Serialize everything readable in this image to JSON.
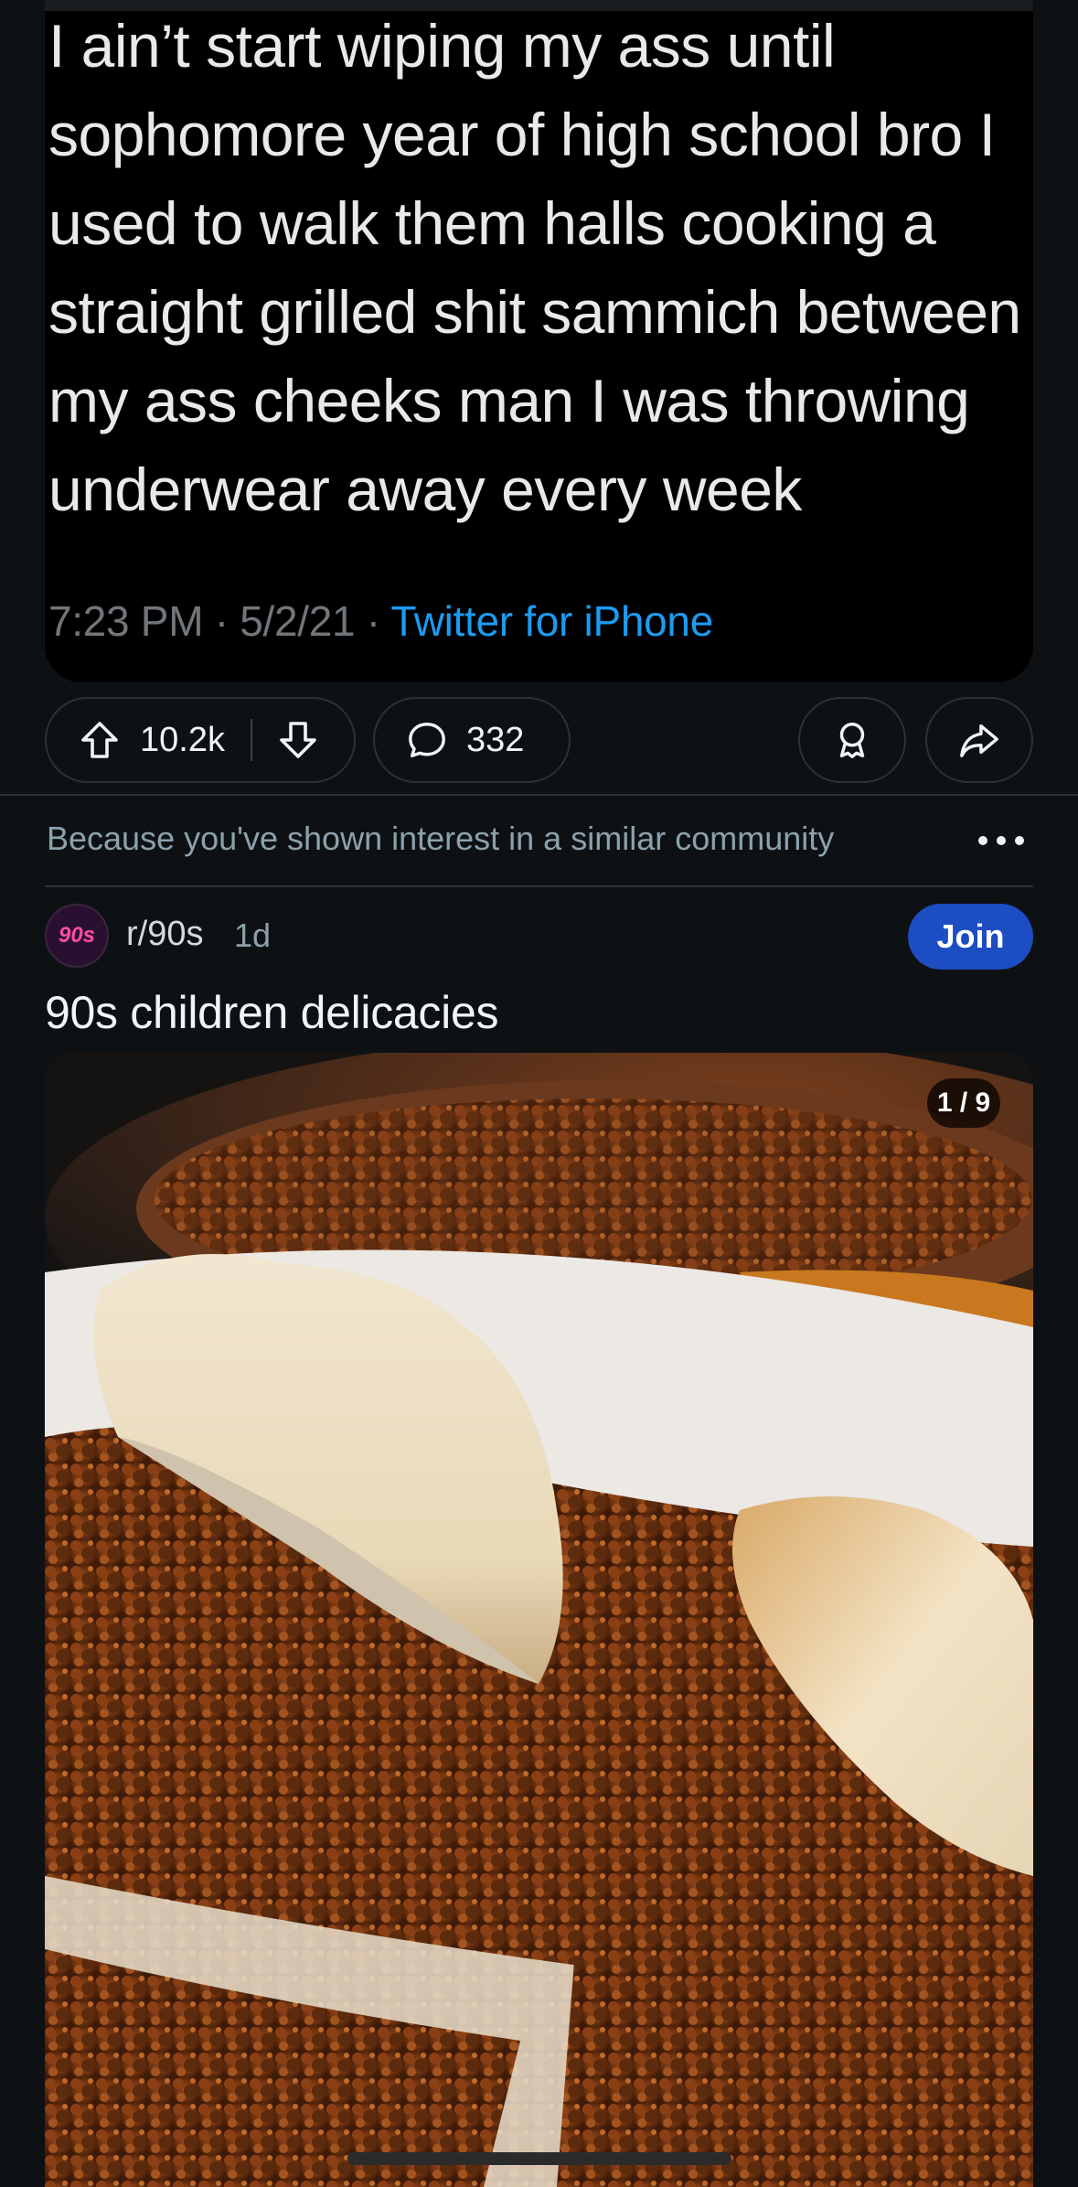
{
  "tweet": {
    "text": "I ain’t start wiping my ass until sophomore year of high school bro I used to walk them halls cooking a straight grilled shit sammich between my ass cheeks man I was throwing underwear away every week",
    "lines": [
      "I ain’t start wiping my ass until",
      "sophomore year of high school bro I",
      "used to walk them halls cooking a",
      "straight grilled shit sammich between",
      "my ass cheeks man I was throwing",
      "underwear away every week"
    ],
    "time": "7:23 PM · 5/2/21 · ",
    "app": "Twitter for iPhone"
  },
  "actions": {
    "upvote_count": "10.2k",
    "comment_count": "332",
    "icons": [
      "upvote-icon",
      "downvote-icon",
      "comment-icon",
      "award-icon",
      "share-icon"
    ]
  },
  "recommendation": {
    "reason": "Because you've shown interest in a similar community"
  },
  "post": {
    "subreddit": "r/90s",
    "avatar_text": "90s",
    "age": "1d",
    "join_label": "Join",
    "title": "90s children delicacies",
    "image_counter": "1 / 9"
  },
  "colors": {
    "background": "#0e1113",
    "join_button": "#1c4dc2",
    "twitter_link": "#1d9bf0",
    "meta_text": "#8ba2ad"
  }
}
